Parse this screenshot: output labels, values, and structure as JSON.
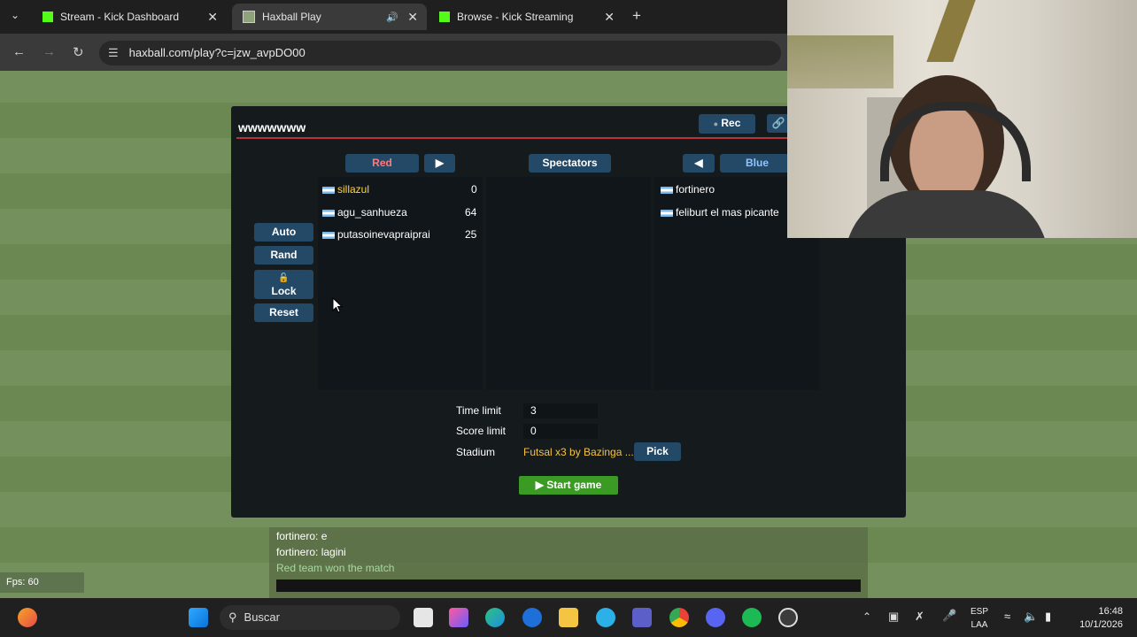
{
  "browser": {
    "tabs": [
      {
        "title": "Stream - Kick Dashboard",
        "active": false
      },
      {
        "title": "Haxball Play",
        "active": true
      },
      {
        "title": "Browse - Kick Streaming",
        "active": false
      }
    ],
    "url": "haxball.com/play?c=jzw_avpDO00"
  },
  "room": {
    "title": "wwwwwww",
    "rec_label": "Rec",
    "teams": {
      "red_label": "Red",
      "spectators_label": "Spectators",
      "blue_label": "Blue"
    },
    "red_players": [
      {
        "name": "sillazul",
        "score": "0"
      },
      {
        "name": "agu_sanhueza",
        "score": "64"
      },
      {
        "name": "putasoinevapraiprai",
        "score": "25"
      }
    ],
    "blue_players": [
      {
        "name": "fortinero"
      },
      {
        "name": "feliburt el mas picante"
      }
    ],
    "side_buttons": {
      "auto": "Auto",
      "rand": "Rand",
      "lock": "Lock",
      "reset": "Reset"
    },
    "settings": {
      "time_limit_label": "Time limit",
      "time_limit_value": "3",
      "score_limit_label": "Score limit",
      "score_limit_value": "0",
      "stadium_label": "Stadium",
      "stadium_value": "Futsal x3 by Bazinga ...",
      "pick_label": "Pick"
    },
    "start_label": "Start game"
  },
  "chat": {
    "lines": [
      "fortinero: e",
      "fortinero: lagini",
      "Red team won the match"
    ],
    "colors": {
      "message": "#ffffff",
      "system": "#a9d8a0"
    }
  },
  "fps": "Fps: 60",
  "taskbar": {
    "search_label": "Buscar",
    "lang_top": "ESP",
    "lang_bottom": "LAA",
    "time": "16:48",
    "date": "10/1/2026"
  },
  "colors": {
    "accent_red": "#b8323e",
    "button_blue": "#244967",
    "start_green": "#3a9a23"
  }
}
